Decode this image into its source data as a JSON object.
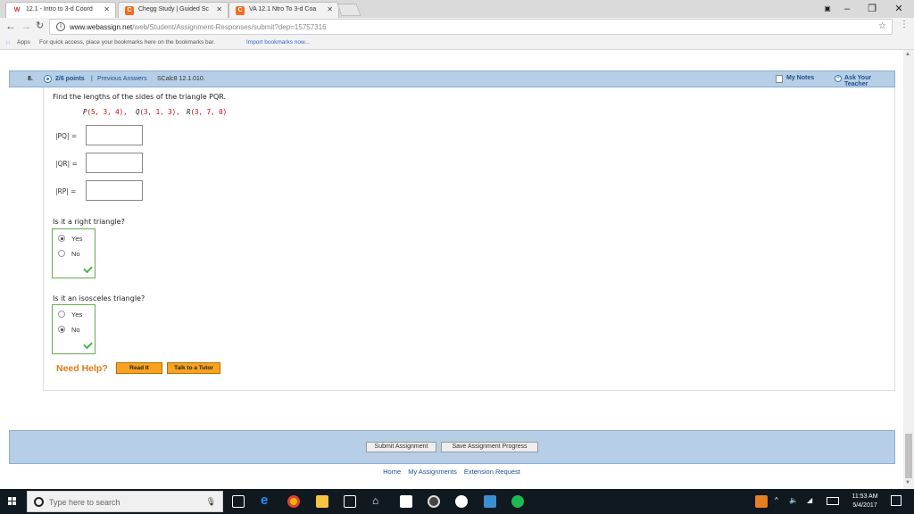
{
  "browser": {
    "tabs": [
      {
        "title": "12.1 - Intro to 3-d Coord",
        "favicon": "webassign-icon"
      },
      {
        "title": "Chegg Study | Guided Sc",
        "favicon": "chegg-icon"
      },
      {
        "title": "VA 12.1 Ntro To 3-d Coa",
        "favicon": "chegg-icon"
      }
    ],
    "url_host": "www.webassign.net",
    "url_path": "/web/Student/Assignment-Responses/submit?dep=15757316",
    "bookmarks_apps": "Apps",
    "bookmarks_hint": "For quick access, place your bookmarks here on the bookmarks bar.",
    "bookmarks_import": "Import bookmarks now..."
  },
  "question": {
    "number": "8.",
    "points": "2/6 points",
    "separator": "|",
    "previous_answers": "Previous Answers",
    "code": "SCalc8 12.1.010.",
    "my_notes": "My Notes",
    "ask_teacher": "Ask Your Teacher",
    "prompt": "Find the lengths of the sides of the triangle PQR.",
    "points_def": [
      {
        "label": "P",
        "coords": "(5, 3, 4),"
      },
      {
        "label": "Q",
        "coords": "(3, 1, 3),"
      },
      {
        "label": "R",
        "coords": "(3, 7, 0)"
      }
    ],
    "lengths": [
      {
        "label": "|PQ|  =",
        "value": ""
      },
      {
        "label": "|QR|  =",
        "value": ""
      },
      {
        "label": "|RP|  =",
        "value": ""
      }
    ],
    "right_question": "Is it a right triangle?",
    "right_options": [
      "Yes",
      "No"
    ],
    "right_selected": "Yes",
    "isosceles_question": "Is it an isosceles triangle?",
    "isosceles_options": [
      "Yes",
      "No"
    ],
    "isosceles_selected": "No",
    "need_help": "Need Help?",
    "read_it": "Read It",
    "talk_tutor": "Talk to a Tutor"
  },
  "footer": {
    "submit": "Submit Assignment",
    "save": "Save Assignment Progress",
    "links": [
      "Home",
      "My Assignments",
      "Extension Request"
    ]
  },
  "taskbar": {
    "search_placeholder": "Type here to search",
    "time": "11:53 AM",
    "date": "5/4/2017"
  },
  "colors": {
    "header_bg": "#b6cfe7",
    "accent_orange": "#f7a320",
    "link_blue": "#1f4f8b",
    "correct_green": "#6aa84f"
  }
}
